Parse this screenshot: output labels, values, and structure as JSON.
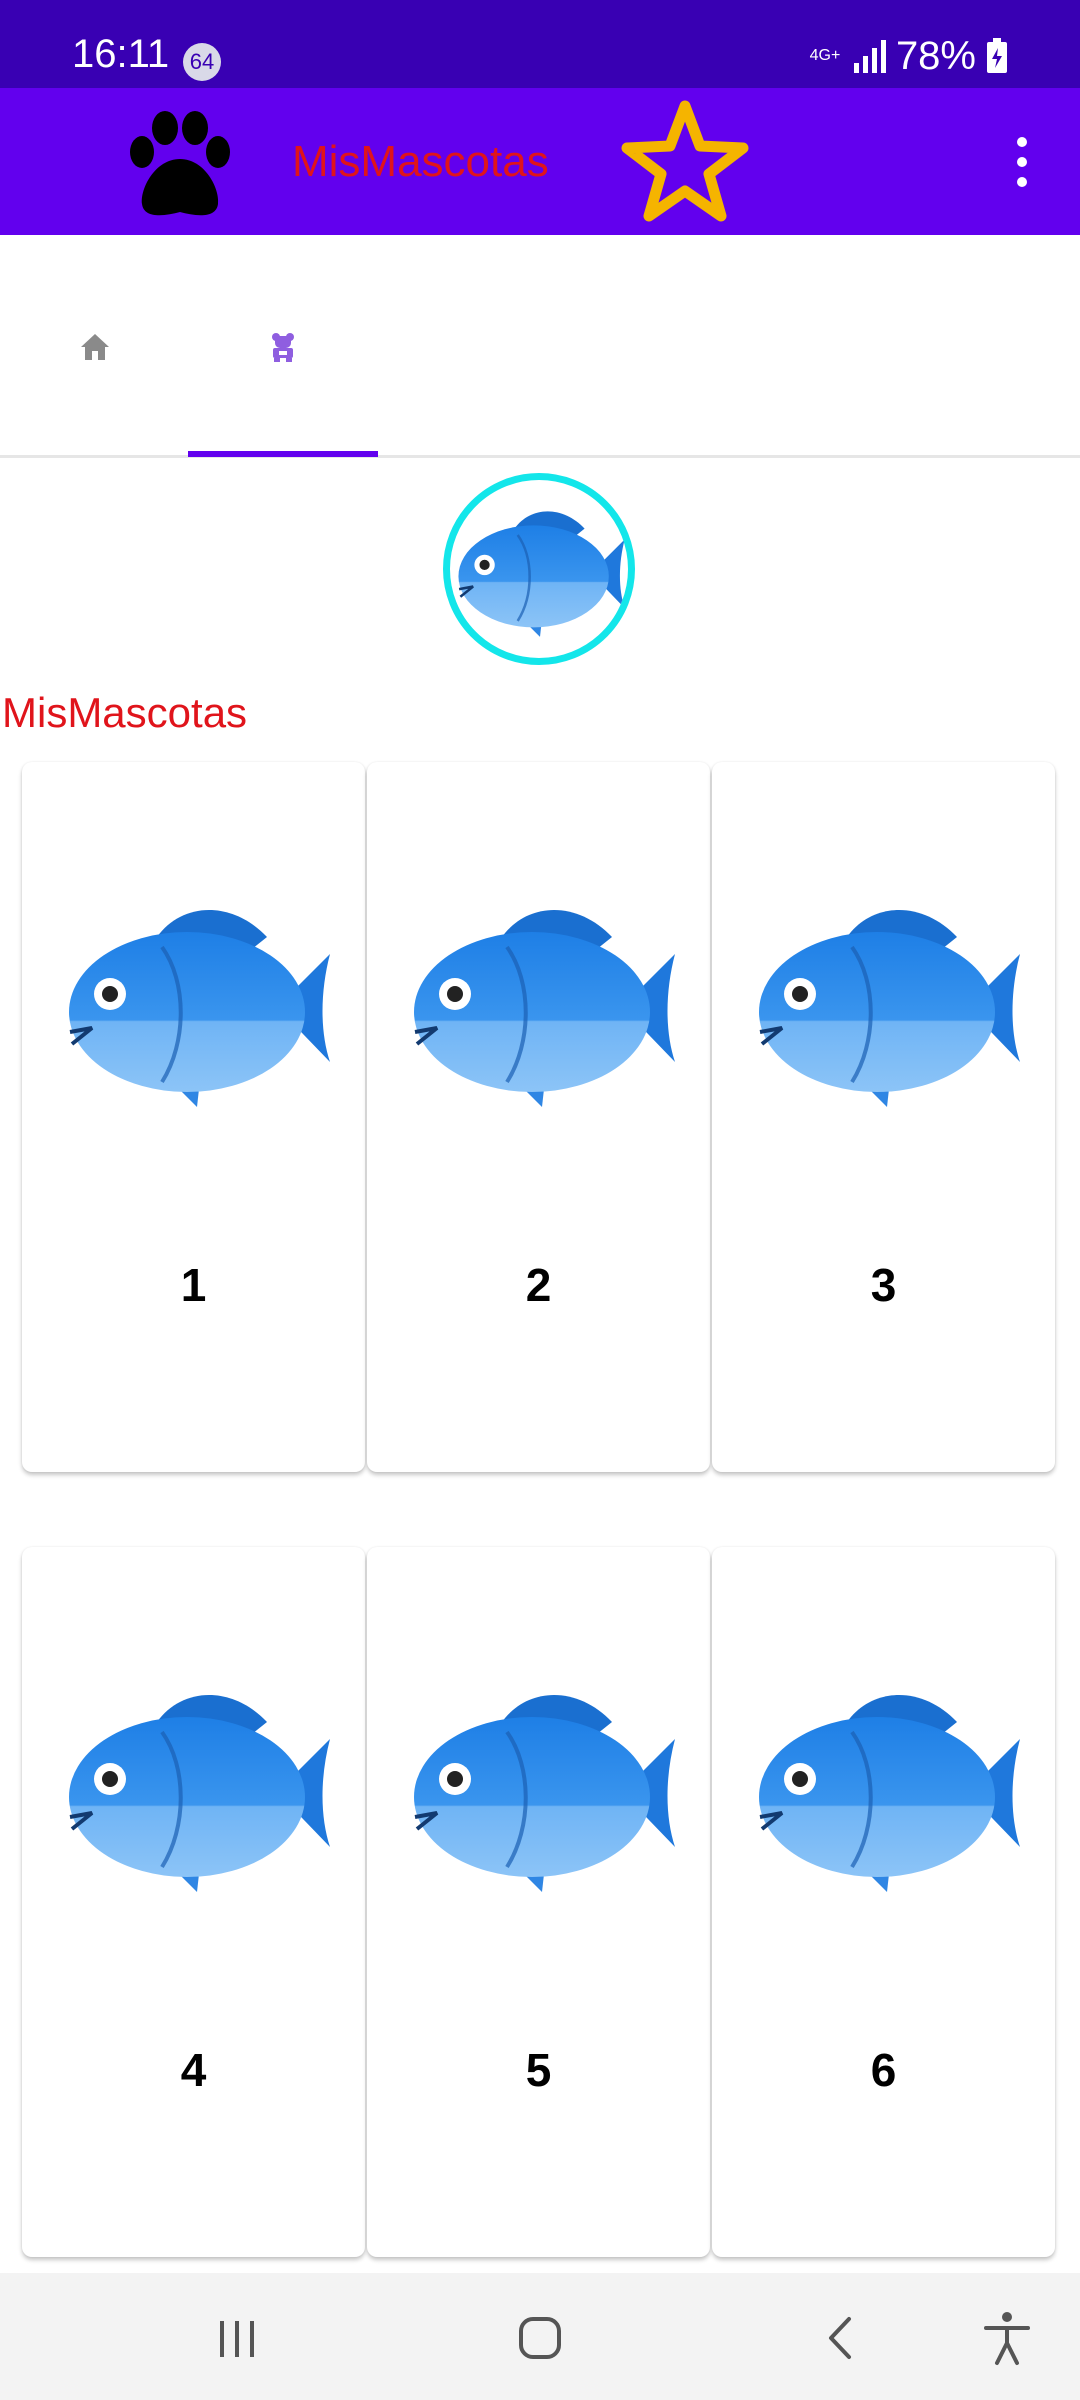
{
  "status_bar": {
    "time": "16:11",
    "notification_count": "64",
    "network": "4G+",
    "battery": "78%"
  },
  "app_bar": {
    "title": "MisMascotas",
    "logo_icon": "paw-icon",
    "favorite_icon": "star-icon",
    "menu_icon": "overflow-menu-icon"
  },
  "tabs": [
    {
      "icon": "home-icon",
      "selected": false
    },
    {
      "icon": "pet-icon",
      "selected": true
    }
  ],
  "profile": {
    "name": "MisMascotas",
    "avatar_icon": "fish-icon"
  },
  "pets": [
    {
      "label": "1",
      "image": "fish-icon"
    },
    {
      "label": "2",
      "image": "fish-icon"
    },
    {
      "label": "3",
      "image": "fish-icon"
    },
    {
      "label": "4",
      "image": "fish-icon"
    },
    {
      "label": "5",
      "image": "fish-icon"
    },
    {
      "label": "6",
      "image": "fish-icon"
    }
  ],
  "colors": {
    "status_bar": "#3900b3",
    "app_bar": "#6200ee",
    "title_red": "#e0141b",
    "profile_ring": "#13e6ea",
    "star": "#f5b400"
  },
  "nav_bar": [
    "recents-icon",
    "home-circle-icon",
    "back-icon",
    "accessibility-icon"
  ]
}
